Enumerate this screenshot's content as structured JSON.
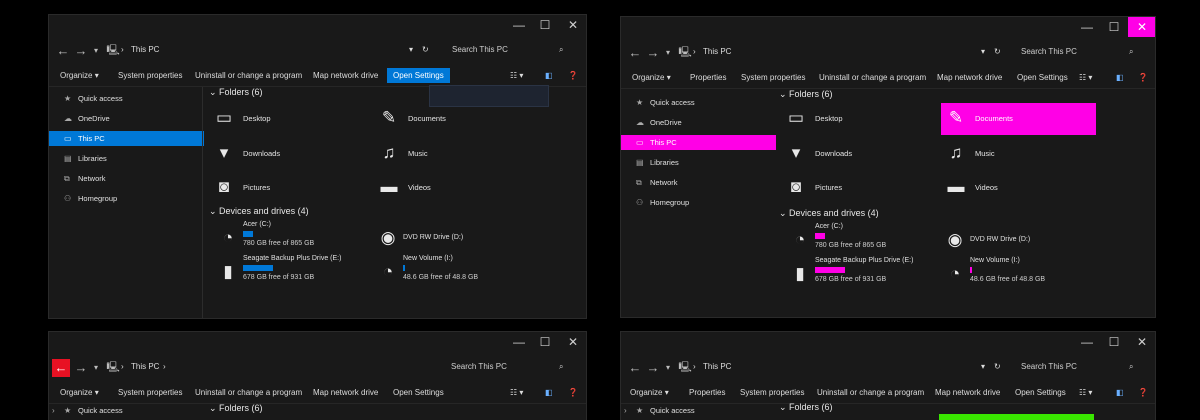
{
  "common": {
    "location": "This PC",
    "search_placeholder": "Search This PC",
    "folders_header": "Folders (6)",
    "devices_header": "Devices and drives (4)",
    "sidebar": [
      "Quick access",
      "OneDrive",
      "This PC",
      "Libraries",
      "Network",
      "Homegroup"
    ],
    "folders": [
      "Desktop",
      "Documents",
      "Downloads",
      "Music",
      "Pictures",
      "Videos"
    ],
    "drives": [
      {
        "name": "Acer (C:)",
        "free": "780 GB free of 865 GB",
        "used_fraction": 0.1
      },
      {
        "name": "DVD RW Drive (D:)",
        "free": "",
        "used_fraction": null
      },
      {
        "name": "Seagate Backup Plus Drive (E:)",
        "free": "678 GB free of 931 GB",
        "used_fraction": 0.27
      },
      {
        "name": "New Volume (I:)",
        "free": "48.6 GB free of 48.8 GB",
        "used_fraction": 0.01
      }
    ],
    "ribbon_organize": "Organize",
    "ribbon_properties": "Properties",
    "ribbon_system_properties": "System properties",
    "ribbon_uninstall": "Uninstall or change a program",
    "ribbon_map_drive": "Map network drive",
    "ribbon_open_settings": "Open Settings",
    "window_controls": {
      "minimize": "—",
      "maximize": "☐",
      "close": "✕"
    }
  },
  "accents": {
    "blue": "#0078d7",
    "magenta": "#ff00e6",
    "red": "#e81123",
    "green": "#39e600"
  }
}
